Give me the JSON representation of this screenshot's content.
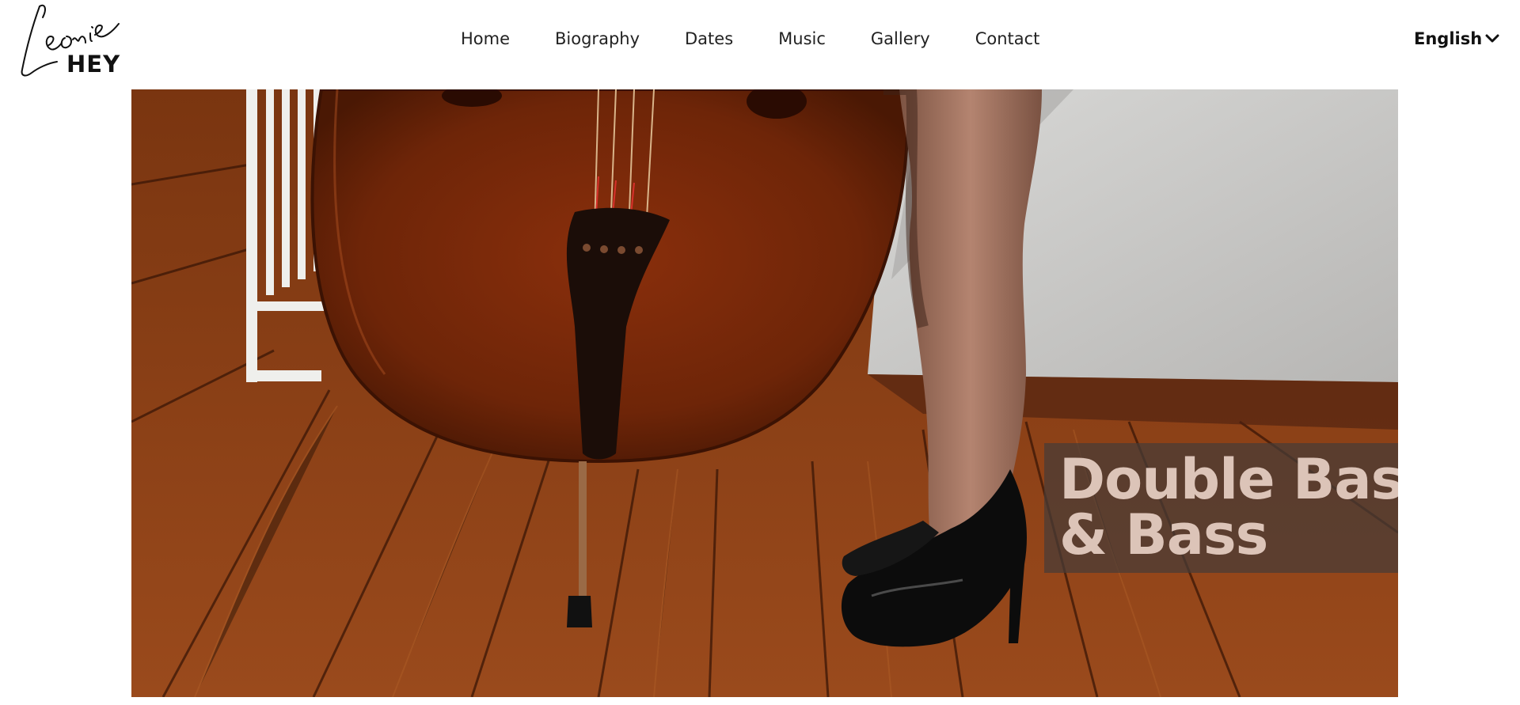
{
  "brand": {
    "script_name": "Leonie",
    "surname": "HEY"
  },
  "nav": {
    "items": [
      {
        "label": "Home"
      },
      {
        "label": "Biography"
      },
      {
        "label": "Dates"
      },
      {
        "label": "Music"
      },
      {
        "label": "Gallery"
      },
      {
        "label": "Contact"
      }
    ]
  },
  "language": {
    "selected": "English",
    "icon": "chevron-down-icon"
  },
  "hero": {
    "image": "double-bass-and-high-heels-photo",
    "caption_line1": "Double Bass",
    "caption_line2": "& Bass"
  },
  "colors": {
    "caption_text": "#dcc4b8",
    "caption_bg": "#463c38",
    "wood": "#8e4318"
  }
}
